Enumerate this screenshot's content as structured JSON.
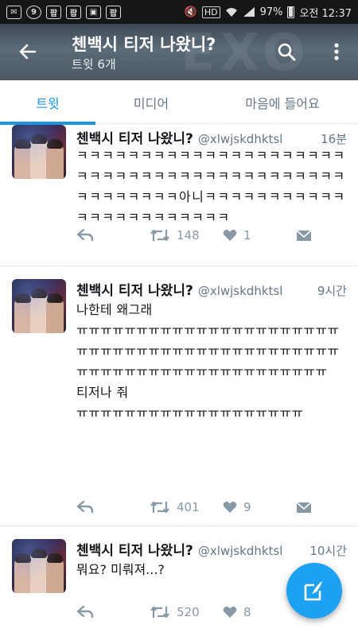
{
  "status_bar": {
    "battery": "97%",
    "time": "오전 12:37",
    "hd": "HD",
    "left_badges": [
      "9",
      "팝",
      "팝",
      "팝"
    ]
  },
  "header": {
    "title": "첸백시 티저 나왔니?",
    "subtitle": "트윗 6개",
    "icons": [
      "back-arrow-icon",
      "search-icon",
      "more-vertical-icon"
    ],
    "color": "#4c5864"
  },
  "tabs": [
    {
      "label": "트윗",
      "active": true
    },
    {
      "label": "미디어",
      "active": false
    },
    {
      "label": "마음에 들어요",
      "active": false
    }
  ],
  "accent": "#1b95e0",
  "tweets": [
    {
      "name": "첸백시 티저 나왔니?",
      "handle": "@xlwjskdhktsl",
      "time": "16분",
      "text": "ㅋㅋㅋㅋㅋㅋㅋㅋㅋㅋㅋㅋㅋㅋㅋㅋㅋㅋㅋㅋㅋㅋㅋㅋㅋㅋㅋㅋㅋㅋㅋㅋㅋㅋㅋㅋㅋㅋㅋㅋㅋㅋㅋㅋㅋㅋㅋㅋㅋㅋ아니ㅋㅋㅋㅋㅋㅋㅋㅋㅋㅋㅋㅋㅋㅋㅋㅋㅋㅋㅋㅋㅋㅋㅋ",
      "retweets": "148",
      "likes": "1"
    },
    {
      "name": "첸백시 티저 나왔니?",
      "handle": "@xlwjskdhktsl",
      "time": "9시간",
      "text": "나한테 왜그래\nㅠㅠㅠㅠㅠㅠㅠㅠㅠㅠㅠㅠㅠㅠㅠㅠㅠㅠㅠㅠㅠㅠㅠㅠㅠㅠㅠㅠㅠㅠㅠㅠㅠㅠㅠㅠㅠㅠㅠㅠㅠㅠㅠㅠㅠㅠㅠㅠㅠㅠㅠㅠㅠㅠㅠㅠㅠㅠㅠㅠㅠㅠㅠㅠㅠ\n티저나 줘\nㅠㅠㅠㅠㅠㅠㅠㅠㅠㅠㅠㅠㅠㅠㅠㅠㅠㅠㅠ",
      "retweets": "401",
      "likes": "9"
    },
    {
      "name": "첸백시 티저 나왔니?",
      "handle": "@xlwjskdhktsl",
      "time": "10시간",
      "text": "뭐요? 미뤄져...?",
      "retweets": "520",
      "likes": "8"
    }
  ],
  "fab_icon": "compose-tweet-icon"
}
